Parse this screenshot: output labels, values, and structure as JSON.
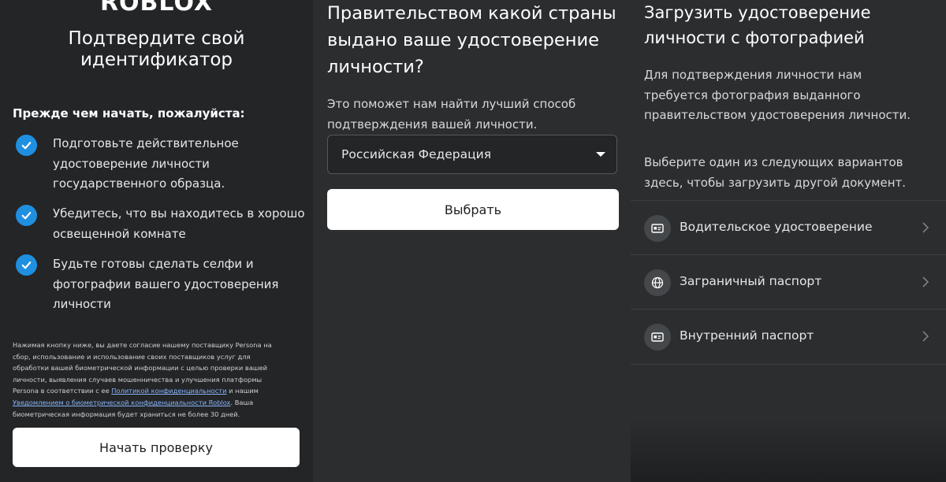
{
  "left": {
    "logo": "ROBLOX",
    "title_line1": "Подтвердите свой",
    "title_line2": "идентификатор",
    "before_heading": "Прежде чем начать, пожалуйста:",
    "checklist": [
      {
        "line1": "Подготовьте действительное",
        "line2": "удостоверение личности",
        "line3": "государственного образца."
      },
      {
        "line1": "Убедитесь, что вы находитесь в хорошо",
        "line2": "освещенной комнате",
        "line3": ""
      },
      {
        "line1": "Будьте готовы сделать селфи и",
        "line2": "фотографии вашего удостоверения",
        "line3": "личности"
      }
    ],
    "consent": {
      "line1": "Нажимая кнопку ниже, вы даете согласие нашему поставщику Persona на",
      "line2": "сбор, использование и использование своих поставщиков услуг для",
      "line3": "обработки вашей биометрической информации с целью проверки вашей",
      "line4": "личности, выявления случаев мошенничества и улучшения платформы",
      "line5_pre": "Persona в соответствии с ее ",
      "line5_link": "Политикой конфиденциальности",
      "line5_post": " и нашим",
      "line6_link": "Уведомлением о биометрической конфиденциальности Roblox",
      "line6_post": ". Ваша",
      "line7": "биометрическая информация будет храниться не более 30 дней."
    },
    "start_button": "Начать проверку"
  },
  "middle": {
    "title_line1": "Правительством какой страны",
    "title_line2": "выдано ваше удостоверение",
    "title_line3": "личности?",
    "subtitle_line1": "Это поможет нам найти лучший способ",
    "subtitle_line2": "подтверждения вашей личности.",
    "country_select": "Российская Федерация",
    "choose_button": "Выбрать"
  },
  "right": {
    "title_line1": "Загрузить удостоверение",
    "title_line2": "личности с фотографией",
    "desc1_line1": "Для подтверждения личности нам",
    "desc1_line2": "требуется фотография выданного",
    "desc1_line3": "правительством удостоверения личности.",
    "desc2_line1": "Выберите один из следующих вариантов",
    "desc2_line2": "здесь, чтобы загрузить другой документ.",
    "options": [
      {
        "label": "Водительское удостоверение",
        "icon": "id-card-icon"
      },
      {
        "label": "Заграничный паспорт",
        "icon": "globe-icon"
      },
      {
        "label": "Внутренний паспорт",
        "icon": "id-card-icon"
      }
    ]
  },
  "colors": {
    "check": "#1f8fe0",
    "link": "#8ab4f8",
    "background": "#232527"
  }
}
